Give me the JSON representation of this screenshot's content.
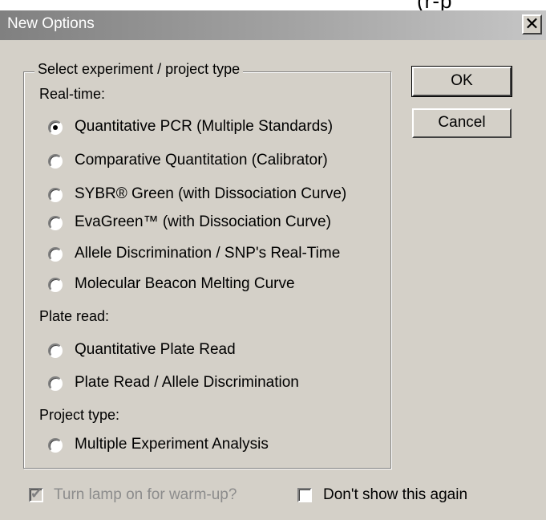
{
  "background_text": "(r-p",
  "window": {
    "title": "New Options",
    "close_glyph": "✕"
  },
  "group": {
    "legend": "Select experiment / project  type",
    "sections": {
      "realtime": "Real-time:",
      "plate_read": "Plate read:",
      "project_type": "Project type:"
    },
    "options": [
      {
        "label": "Quantitative PCR (Multiple Standards)",
        "checked": true
      },
      {
        "label": "Comparative Quantitation (Calibrator)",
        "checked": false
      },
      {
        "label": "SYBR® Green (with Dissociation Curve)",
        "checked": false
      },
      {
        "label": "EvaGreen™ (with Dissociation Curve)",
        "checked": false
      },
      {
        "label": "Allele Discrimination / SNP's Real-Time",
        "checked": false
      },
      {
        "label": "Molecular Beacon Melting Curve",
        "checked": false
      },
      {
        "label": "Quantitative Plate Read",
        "checked": false
      },
      {
        "label": "Plate Read / Allele Discrimination",
        "checked": false
      },
      {
        "label": "Multiple Experiment Analysis",
        "checked": false
      }
    ]
  },
  "buttons": {
    "ok": "OK",
    "cancel": "Cancel"
  },
  "checkboxes": {
    "lamp": {
      "label": "Turn lamp on for warm-up?",
      "checked": true,
      "disabled": true
    },
    "dont_show": {
      "label": "Don't show this again",
      "checked": false
    }
  }
}
